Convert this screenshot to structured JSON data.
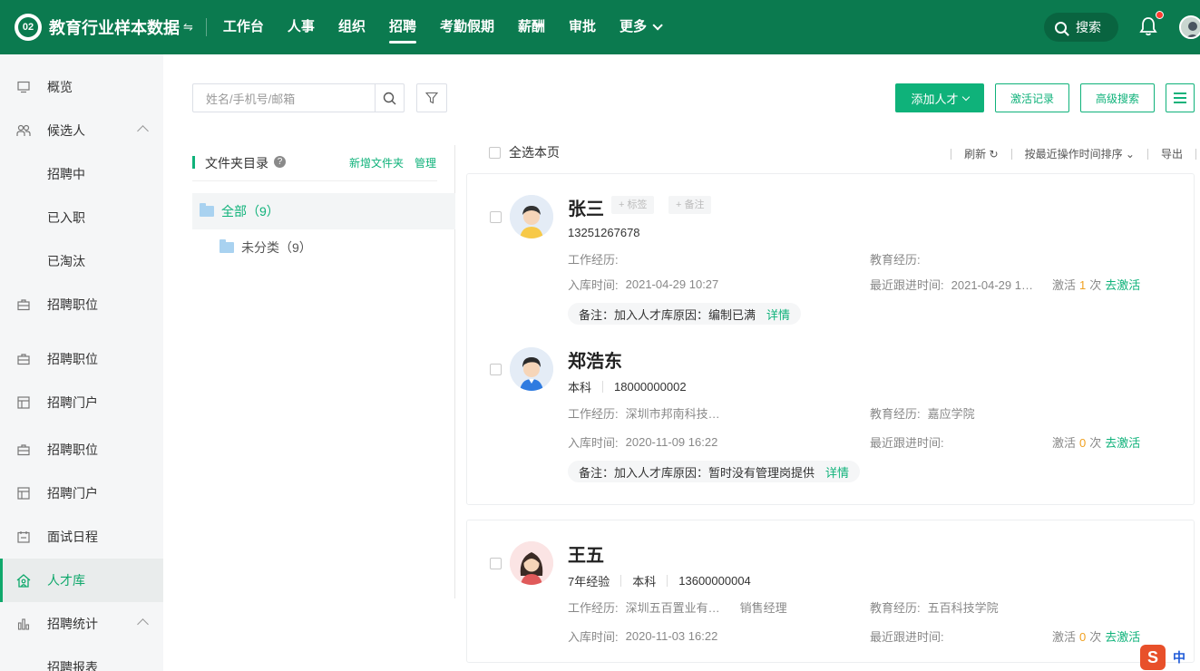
{
  "header": {
    "logo_text": "02",
    "company": "教育行业样本数据",
    "nav": [
      {
        "label": "工作台"
      },
      {
        "label": "人事"
      },
      {
        "label": "组织"
      },
      {
        "label": "招聘",
        "active": true
      },
      {
        "label": "考勤假期"
      },
      {
        "label": "薪酬"
      },
      {
        "label": "审批"
      },
      {
        "label": "更多"
      }
    ],
    "search_label": "搜索",
    "accent": "#0b7a4f"
  },
  "sidebar": {
    "items": [
      {
        "label": "概览",
        "icon": "monitor-icon"
      },
      {
        "label": "候选人",
        "icon": "people-icon",
        "expanded": true
      },
      {
        "label": "招聘中",
        "sub": true
      },
      {
        "label": "已入职",
        "sub": true
      },
      {
        "label": "已淘汰",
        "sub": true
      },
      {
        "label": "招聘职位",
        "icon": "briefcase-icon"
      },
      {
        "label": "招聘职位",
        "icon": "briefcase-icon"
      },
      {
        "label": "招聘门户",
        "icon": "portal-icon"
      },
      {
        "label": "招聘职位",
        "icon": "briefcase-icon"
      },
      {
        "label": "招聘门户",
        "icon": "portal-icon"
      },
      {
        "label": "面试日程",
        "icon": "calendar-icon"
      },
      {
        "label": "人才库",
        "icon": "talent-icon",
        "active": true
      },
      {
        "label": "招聘统计",
        "icon": "chart-icon",
        "expanded": true
      },
      {
        "label": "招聘报表",
        "sub": true
      }
    ],
    "active_color": "#0fa86b"
  },
  "toolbar": {
    "search_placeholder": "姓名/手机号/邮箱",
    "add_label": "添加人才",
    "activation_label": "激活记录",
    "advanced_label": "高级搜索"
  },
  "folders": {
    "title": "文件夹目录",
    "help": "?",
    "new_label": "新增文件夹",
    "manage_label": "管理",
    "all_label": "全部（9）",
    "uncategorized_label": "未分类（9）"
  },
  "list": {
    "select_all": "全选本页",
    "refresh": "刷新",
    "sort": "按最近操作时间排序",
    "export": "导出"
  },
  "candidates": [
    {
      "name": "张三",
      "tag_label": "+ 标签",
      "remark_label": "+ 备注",
      "phone": "13251267678",
      "work_label": "工作经历:",
      "work": "",
      "edu_label": "教育经历:",
      "edu": "",
      "added_label": "入库时间:",
      "added": "2021-04-29 10:27",
      "follow_label": "最近跟进时间:",
      "follow": "2021-04-29 1…",
      "activate_prefix": "激活",
      "activate_count": "1",
      "activate_suffix": "次",
      "activate_link": "去激活",
      "note": "备注：加入人才库原因：编制已满",
      "note_link": "详情"
    },
    {
      "name": "郑浩东",
      "degree": "本科",
      "phone": "18000000002",
      "work_label": "工作经历:",
      "work": "深圳市邦南科技…",
      "edu_label": "教育经历:",
      "edu": "嘉应学院",
      "added_label": "入库时间:",
      "added": "2020-11-09 16:22",
      "follow_label": "最近跟进时间:",
      "follow": "",
      "activate_prefix": "激活",
      "activate_count": "0",
      "activate_suffix": "次",
      "activate_link": "去激活",
      "note": "备注：加入人才库原因：暂时没有管理岗提供",
      "note_link": "详情"
    },
    {
      "name": "王五",
      "experience": "7年经验",
      "degree": "本科",
      "phone": "13600000004",
      "work_label": "工作经历:",
      "work": "深圳五百置业有…",
      "position": "销售经理",
      "edu_label": "教育经历:",
      "edu": "五百科技学院",
      "added_label": "入库时间:",
      "added": "2020-11-03 16:22",
      "follow_label": "最近跟进时间:",
      "follow": "",
      "activate_prefix": "激活",
      "activate_count": "0",
      "activate_suffix": "次",
      "activate_link": "去激活"
    }
  ],
  "ime": {
    "logo": "S",
    "label": "中"
  }
}
